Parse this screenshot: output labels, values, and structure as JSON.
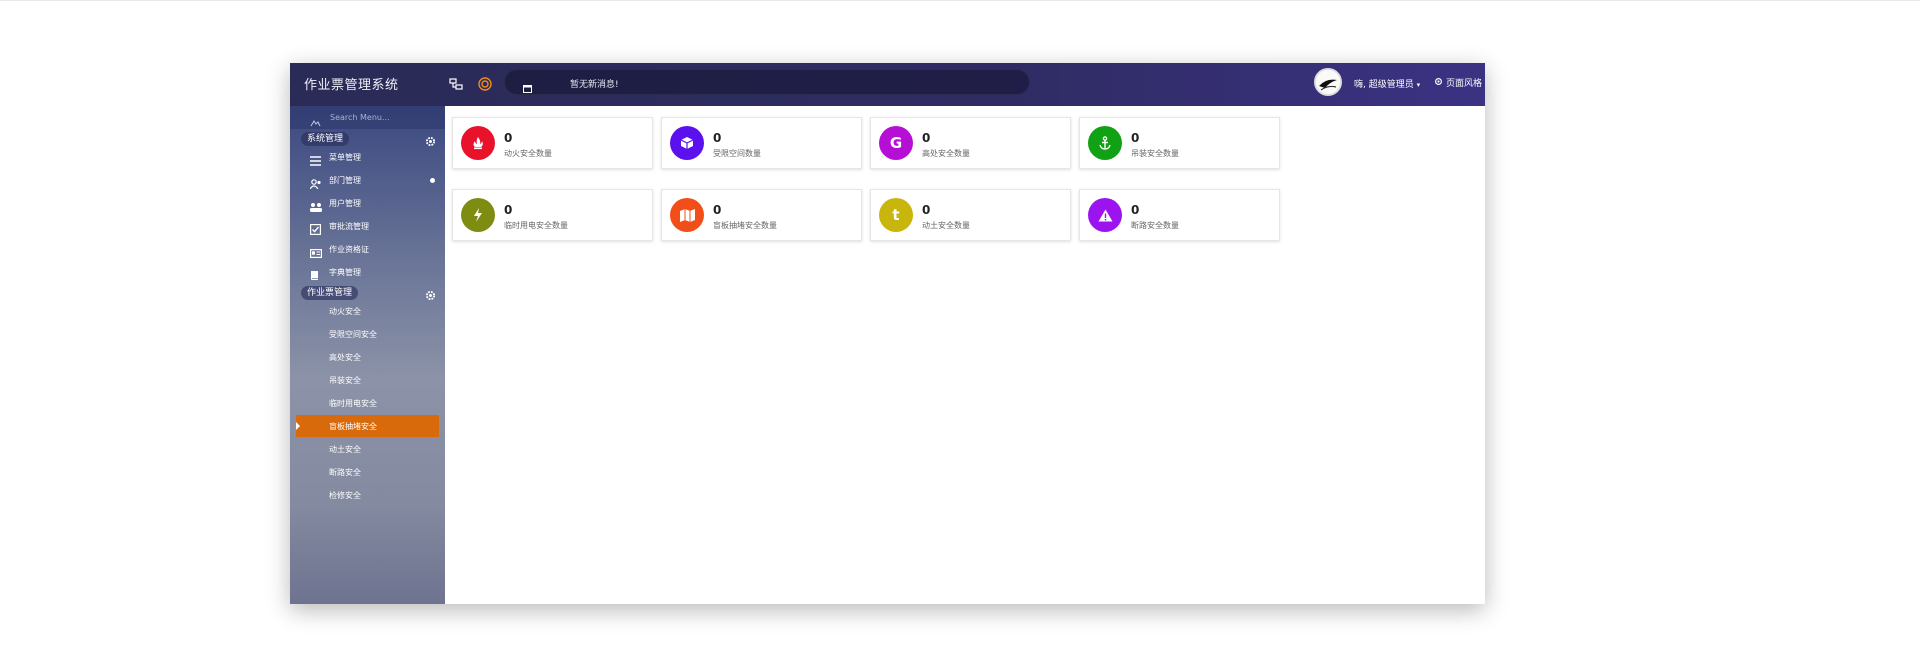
{
  "header": {
    "app_title": "作业票管理系统",
    "notice": "暂无新消息!",
    "user": "嗨, 超级管理员",
    "style_label": "页面风格",
    "colors": {
      "gradient_start": "#2a2b56",
      "gradient_end": "#3b3283"
    }
  },
  "sidebar": {
    "search_placeholder": "Search Menu...",
    "sections": [
      {
        "label": "系统管理",
        "items": [
          {
            "label": "菜单管理",
            "icon": "list-icon"
          },
          {
            "label": "部门管理",
            "icon": "users-icon",
            "dot": true
          },
          {
            "label": "用户管理",
            "icon": "user-group-icon"
          },
          {
            "label": "审批流管理",
            "icon": "checkbox-icon"
          },
          {
            "label": "作业资格证",
            "icon": "id-card-icon"
          },
          {
            "label": "字典管理",
            "icon": "book-icon"
          }
        ]
      },
      {
        "label": "作业票管理",
        "items": [
          {
            "label": "动火安全"
          },
          {
            "label": "受限空间安全"
          },
          {
            "label": "高处安全"
          },
          {
            "label": "吊装安全"
          },
          {
            "label": "临时用电安全"
          },
          {
            "label": "盲板抽堵安全",
            "active": true
          },
          {
            "label": "动土安全"
          },
          {
            "label": "断路安全"
          },
          {
            "label": "检修安全"
          }
        ]
      }
    ],
    "active_color": "#d96a0c"
  },
  "stats": [
    {
      "count": "0",
      "label": "动火安全数量",
      "color": "#e8132b",
      "icon": "fire-icon"
    },
    {
      "count": "0",
      "label": "受限空间数量",
      "color": "#5a11ee",
      "icon": "cube-icon"
    },
    {
      "count": "0",
      "label": "高处安全数量",
      "color": "#b50fd6",
      "icon": "google-icon"
    },
    {
      "count": "0",
      "label": "吊装安全数量",
      "color": "#10a114",
      "icon": "anchor-icon"
    },
    {
      "count": "0",
      "label": "临时用电安全数量",
      "color": "#7e8c12",
      "icon": "bolt-icon"
    },
    {
      "count": "0",
      "label": "盲板抽堵安全数量",
      "color": "#f24e1a",
      "icon": "map-icon"
    },
    {
      "count": "0",
      "label": "动土安全数量",
      "color": "#c8b60d",
      "icon": "tumblr-icon"
    },
    {
      "count": "0",
      "label": "断路安全数量",
      "color": "#9b14f0",
      "icon": "warning-icon"
    }
  ]
}
